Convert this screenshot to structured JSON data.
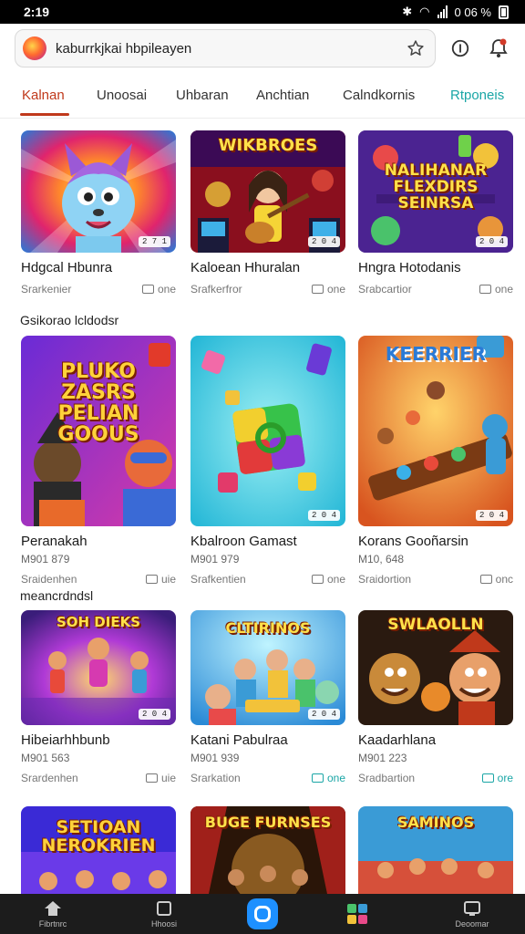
{
  "status_bar": {
    "time": "2:19",
    "right_text": "0 06 %"
  },
  "browser": {
    "url": "kaburrkjkai hbpileayen"
  },
  "tabs": [
    {
      "label": "Kalnan"
    },
    {
      "label": "Unoosai"
    },
    {
      "label": "Uhbaran"
    },
    {
      "label": "Anchtian"
    },
    {
      "label": "Calndkornis"
    },
    {
      "label": "Rtponeis"
    }
  ],
  "sections": [
    {
      "label": "Gsikorao lcldodsr"
    },
    {
      "label": "meancrdndsl"
    }
  ],
  "cards": [
    {
      "title": "Hdgcal Hbunra",
      "sub": "",
      "meta_left": "Srarkenier",
      "meta_right": "one",
      "badge": "2 7 1",
      "thumb_text": ""
    },
    {
      "title": "Kaloean Hhuralan",
      "sub": "",
      "meta_left": "Srafkerfror",
      "meta_right": "one",
      "badge": "2 0 4",
      "thumb_text": "WIKBROES"
    },
    {
      "title": "Hngra Hotodanis",
      "sub": "",
      "meta_left": "Srabcartior",
      "meta_right": "one",
      "badge": "2 0 4",
      "thumb_text": "NALIHANAR FLEXDIRS SEINRSA"
    },
    {
      "title": "Peranakah",
      "sub": "M901 879",
      "meta_left": "Sraidenhen",
      "meta_right": "uie",
      "badge": "",
      "thumb_text": "PLUKO ZASRS PELIAN GOOUS"
    },
    {
      "title": "Kbalroon Gamast",
      "sub": "M901 979",
      "meta_left": "Srafkentien",
      "meta_right": "one",
      "badge": "2 0 4",
      "thumb_text": ""
    },
    {
      "title": "Korans Gooñarsin",
      "sub": "M10, 648",
      "meta_left": "Sraidortion",
      "meta_right": "onc",
      "badge": "2 0 4",
      "thumb_text": "KEERRIER"
    },
    {
      "title": "Hibeiarhhbunb",
      "sub": "M901 563",
      "meta_left": "Srardenhen",
      "meta_right": "uie",
      "badge": "2 0 4",
      "thumb_text": "SOH DIEKS"
    },
    {
      "title": "Katani Pabulraa",
      "sub": "M901 939",
      "meta_left": "Srarkation",
      "meta_right": "one",
      "badge": "2 0 4",
      "thumb_text": "CLTIRINOS"
    },
    {
      "title": "Kaadarhlana",
      "sub": "M901 223",
      "meta_left": "Sradbartion",
      "meta_right": "ore",
      "badge": "",
      "thumb_text": "SWLAOLLN"
    },
    {
      "title": "",
      "sub": "",
      "meta_left": "",
      "meta_right": "",
      "badge": "",
      "thumb_text": "SETIOAN NEROKRIEN"
    },
    {
      "title": "",
      "sub": "",
      "meta_left": "",
      "meta_right": "",
      "badge": "",
      "thumb_text": "BUGE FURNSES"
    },
    {
      "title": "",
      "sub": "",
      "meta_left": "",
      "meta_right": "",
      "badge": "",
      "thumb_text": "SAMINOS"
    }
  ],
  "bottom_nav": [
    {
      "label": "Fibrtnrc",
      "icon": "home-icon"
    },
    {
      "label": "Hhoosi",
      "icon": "square-icon"
    },
    {
      "label": "",
      "icon": "app-icon"
    },
    {
      "label": "",
      "icon": "games-icon"
    },
    {
      "label": "Deoomar",
      "icon": "profile-icon"
    }
  ],
  "colors": {
    "accent": "#c0391b",
    "teal": "#1aa6a6",
    "nav_center": "#1e90ff"
  }
}
